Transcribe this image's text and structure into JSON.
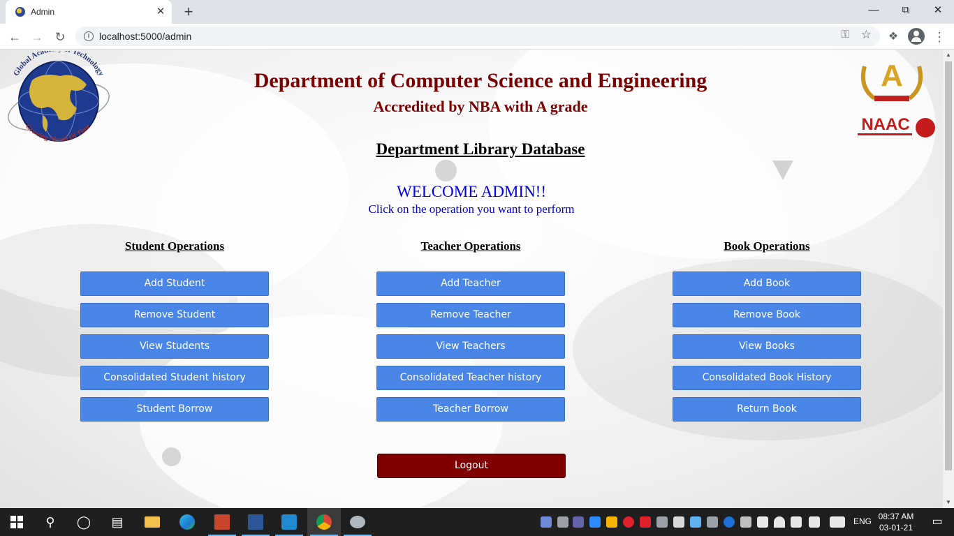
{
  "browser": {
    "tab_title": "Admin",
    "url": "localhost:5000/admin",
    "new_tab_symbol": "+",
    "close_symbol": "✕"
  },
  "header": {
    "title": "Department of Computer Science and Engineering",
    "subtitle": "Accredited by NBA with A grade",
    "library_title": "Department Library Database",
    "welcome": "WELCOME ADMIN!!",
    "instruction": "Click on the operation you want to perform"
  },
  "logos": {
    "left_arc_top": "Global Academy of Technology",
    "left_arc_bottom": "Growing Ahead Of Time",
    "right_text": "NAAC",
    "right_grade": "A"
  },
  "columns": [
    {
      "heading": "Student Operations",
      "buttons": [
        "Add Student",
        "Remove Student",
        "View Students",
        "Consolidated Student history",
        "Student Borrow"
      ]
    },
    {
      "heading": "Teacher Operations",
      "buttons": [
        "Add Teacher",
        "Remove Teacher",
        "View Teachers",
        "Consolidated Teacher history",
        "Teacher Borrow"
      ]
    },
    {
      "heading": "Book Operations",
      "buttons": [
        "Add Book",
        "Remove Book",
        "View Books",
        "Consolidated Book History",
        "Return Book"
      ]
    }
  ],
  "logout_label": "Logout",
  "taskbar": {
    "language": "ENG",
    "time": "08:37 AM",
    "date": "03-01-21"
  },
  "colors": {
    "heading_maroon": "#7a0000",
    "button_blue": "#4a86e8",
    "logout_maroon": "#800000",
    "welcome_blue": "#0000ee"
  }
}
